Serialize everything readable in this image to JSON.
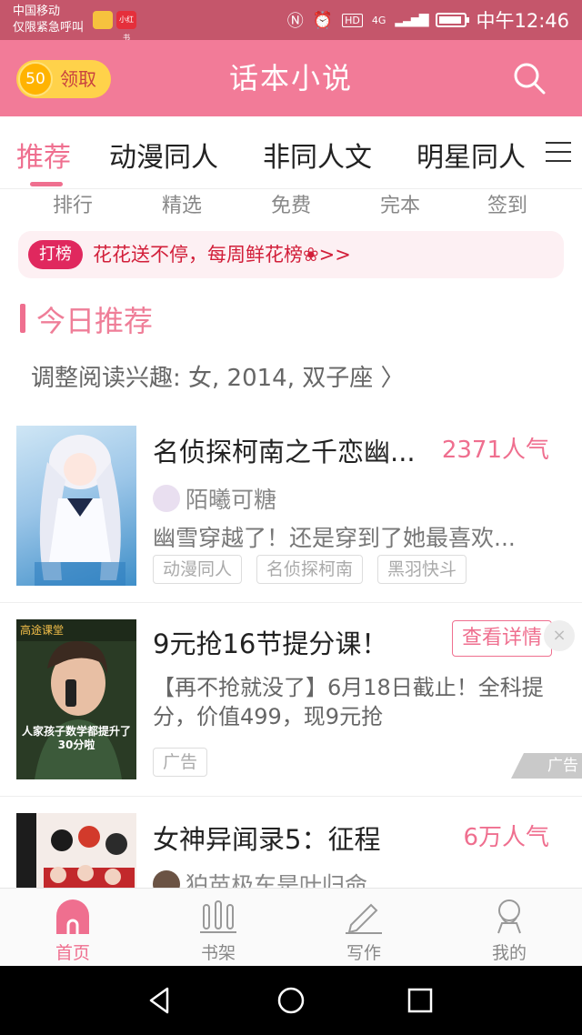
{
  "status_bar": {
    "carrier": "中国移动",
    "emergency": "仅限紧急呼叫",
    "app_badge_text": "小红书",
    "network": "4G",
    "time": "中午12:46"
  },
  "header": {
    "coin_value": "50",
    "coin_label": "领取",
    "title": "话本小说"
  },
  "tabs": {
    "items": [
      "推荐",
      "动漫同人",
      "非同人文",
      "明星同人"
    ],
    "active": 0
  },
  "subnav": [
    "排行",
    "精选",
    "免费",
    "完本",
    "签到"
  ],
  "banner": {
    "tag": "打榜",
    "text": "花花送不停，每周鲜花榜❀>>"
  },
  "section": {
    "title": "今日推荐",
    "prefs": "调整阅读兴趣: 女, 2014, 双子座 〉"
  },
  "cards": [
    {
      "title": "名侦探柯南之千恋幽...",
      "popularity": "2371人气",
      "author": "陌曦可糖",
      "desc": "幽雪穿越了！还是穿到了她最喜欢...",
      "tags": [
        "动漫同人",
        "名侦探柯南",
        "黑羽快斗"
      ]
    },
    {
      "title": "女神异闻录5：征程",
      "popularity": "6万人气",
      "author": "狛苗极车是叶归命"
    }
  ],
  "ad": {
    "title": "9元抢16节提分课！",
    "button": "查看详情",
    "close": "×",
    "desc": "【再不抢就没了】6月18日截止！全科提分，价值499，现9元抢",
    "tag": "广告",
    "corner": "广告",
    "cover_top": "高途课堂",
    "cover_caption": "人家孩子数学都提升了30分啦"
  },
  "bottom_nav": [
    "首页",
    "书架",
    "写作",
    "我的"
  ],
  "colors": {
    "status_bar": "#c5566b",
    "header": "#f27b98",
    "accent": "#ef6f8f"
  }
}
